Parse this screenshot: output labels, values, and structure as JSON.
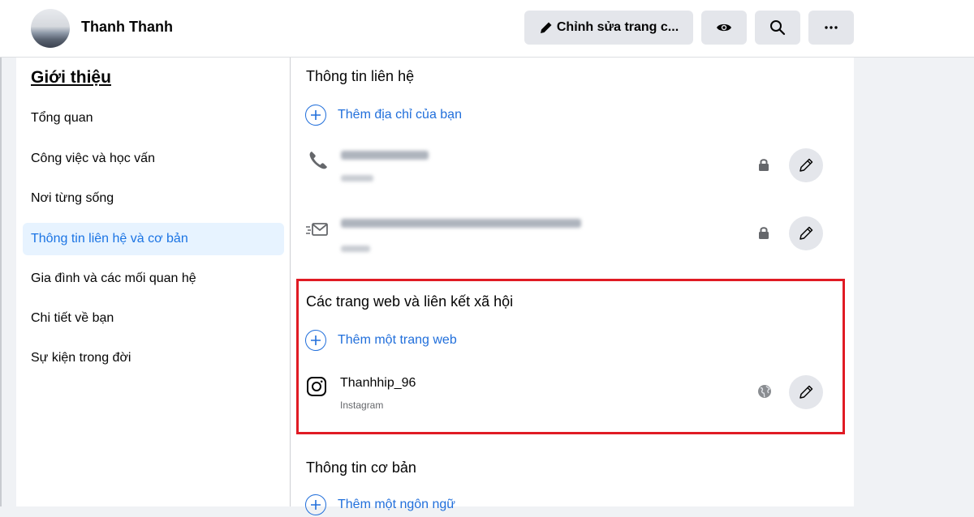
{
  "header": {
    "profile_name": "Thanh Thanh",
    "edit_label": "Chỉnh sửa trang c...",
    "buttons": [
      "eye-icon",
      "search-icon",
      "more-icon"
    ]
  },
  "sidebar": {
    "title": "Giới thiệu",
    "items": [
      {
        "label": "Tổng quan",
        "active": false
      },
      {
        "label": "Công việc và học vấn",
        "active": false
      },
      {
        "label": "Nơi từng sống",
        "active": false
      },
      {
        "label": "Thông tin liên hệ và cơ bản",
        "active": true
      },
      {
        "label": "Gia đình và các mối quan hệ",
        "active": false
      },
      {
        "label": "Chi tiết về bạn",
        "active": false
      },
      {
        "label": "Sự kiện trong đời",
        "active": false
      }
    ]
  },
  "contact": {
    "title": "Thông tin liên hệ",
    "add_address": "Thêm địa chỉ của bạn",
    "phone_icon": "phone-icon",
    "email_icon": "email-icon",
    "privacy_icon": "lock-icon"
  },
  "websites": {
    "title": "Các trang web và liên kết xã hội",
    "add_website": "Thêm một trang web",
    "link": {
      "name": "Thanhhip_96",
      "platform": "Instagram",
      "icon": "instagram-icon",
      "privacy_icon": "globe-icon"
    }
  },
  "basic": {
    "title": "Thông tin cơ bản",
    "add_language": "Thêm một ngôn ngữ"
  },
  "colors": {
    "accent": "#216fdb",
    "active_bg": "#e7f3ff",
    "highlight": "#e01b24",
    "button_bg": "#e4e6eb"
  }
}
